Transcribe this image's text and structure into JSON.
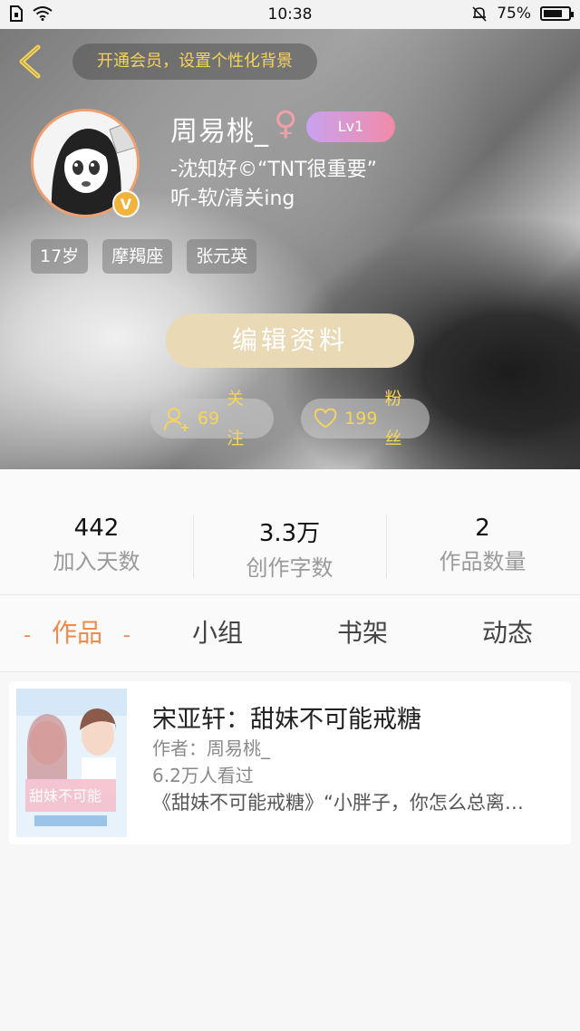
{
  "status_bar": {
    "time": "10:38",
    "battery": "75%",
    "battery_level": 0.75
  },
  "header": {
    "vip_banner": "开通会员，设置个性化背景",
    "nickname": "周易桃_",
    "gender_symbol": "♀",
    "level": "Lv1",
    "v_badge": "V",
    "bio_line1": "-沈知好©“TNT很重要”",
    "bio_line2": "听-软/清关ing",
    "tags": [
      "17岁",
      "摩羯座",
      "张元英"
    ],
    "edit_button": "编辑资料",
    "following_count": "69",
    "following_label": "关注",
    "fans_count": "199",
    "fans_label": "粉丝"
  },
  "stats": [
    {
      "value": "442",
      "label": "加入天数"
    },
    {
      "value": "3.3万",
      "label": "创作字数"
    },
    {
      "value": "2",
      "label": "作品数量"
    }
  ],
  "tabs": {
    "dash": "-",
    "items": [
      "作品",
      "小组",
      "书架",
      "动态"
    ],
    "active": "作品"
  },
  "works": [
    {
      "title": "宋亚轩：甜妹不可能戒糖",
      "author": "作者：周易桃_",
      "views": "6.2万人看过",
      "desc": "《甜妹不可能戒糖》“小胖子，你怎么总离…"
    }
  ],
  "colors": {
    "accent": "#ee8a4a",
    "gold": "#f6d45a",
    "edit_button_bg": "#e9d9b4"
  }
}
